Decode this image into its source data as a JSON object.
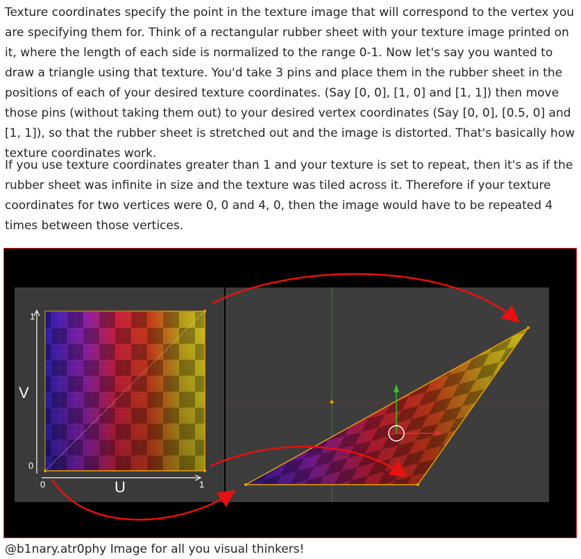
{
  "paragraphs": [
    "Texture coordinates specify the point in the texture image that will correspond to the vertex you are specifying them for. Think of a rectangular rubber sheet with your texture image printed on it, where the length of each side is normalized to the range 0-1. Now let's say you wanted to draw a triangle using that texture. You'd take 3 pins and place them in the rubber sheet in the positions of each of your desired texture coordinates. (Say [0, 0], [1, 0] and [1, 1]) then move those pins (without taking them out) to your desired vertex coordinates (Say [0, 0], [0.5, 0] and [1, 1]), so that the rubber sheet is stretched out and the image is distorted. That's basically how texture coordinates work.",
    "If you use texture coordinates greater than 1 and your texture is set to repeat, then it's as if the rubber sheet was infinite in size and the texture was tiled across it. Therefore if your texture coordinates for two vertices were 0, 0 and 4, 0, then the image would have to be repeated 4 times between those vertices."
  ],
  "figure": {
    "axis_u_label": "U",
    "axis_v_label": "V",
    "tick_zero_x": "0",
    "tick_one_x": "1",
    "tick_zero_y": "0",
    "tick_one_y": "1",
    "colors": {
      "frame_border": "#e0201a",
      "background": "#000000",
      "viewport": "#3d3d3d",
      "arrow": "#e81010",
      "uv_edge": "#e8a000",
      "gizmo_x": "#e03030",
      "gizmo_y": "#30c030"
    }
  },
  "caption": "@b1nary.atr0phy Image for all you visual thinkers!"
}
